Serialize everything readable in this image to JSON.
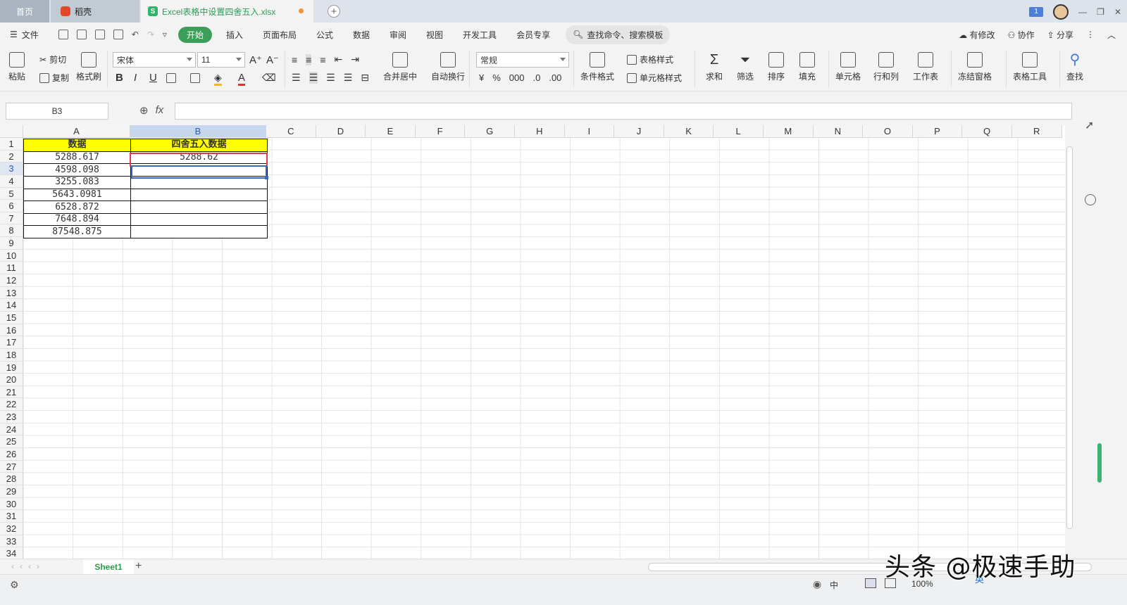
{
  "tabs": {
    "home": "首页",
    "daoke": "稻壳",
    "file_icon_letter": "S",
    "file": "Excel表格中设置四舍五入.xlsx"
  },
  "window_badge": "1",
  "menu": {
    "file": "文件",
    "items": [
      "开始",
      "插入",
      "页面布局",
      "公式",
      "数据",
      "审阅",
      "视图",
      "开发工具",
      "会员专享"
    ],
    "search": "查找命令、搜索模板",
    "right": [
      "有修改",
      "协作",
      "分享"
    ]
  },
  "ribbon": {
    "paste": "粘贴",
    "cut": "剪切",
    "copy": "复制",
    "format_painter": "格式刷",
    "font_name": "宋体",
    "font_size": "11",
    "merge_center": "合并居中",
    "wrap": "自动换行",
    "number_format": "常规",
    "cond_format": "条件格式",
    "table_style": "表格样式",
    "cell_style": "单元格样式",
    "sum": "求和",
    "filter": "筛选",
    "sort": "排序",
    "fill": "填充",
    "cell": "单元格",
    "row_col": "行和列",
    "worksheet": "工作表",
    "freeze": "冻结窗格",
    "table_tools": "表格工具",
    "find": "查找"
  },
  "formula_bar": {
    "name_box": "B3",
    "fx": "fx",
    "formula": ""
  },
  "columns": [
    "A",
    "B",
    "C",
    "D",
    "E",
    "F",
    "G",
    "H",
    "I",
    "J",
    "K",
    "L",
    "M",
    "N",
    "O",
    "P",
    "Q",
    "R"
  ],
  "rows": [
    "1",
    "2",
    "3",
    "4",
    "5",
    "6",
    "7",
    "8",
    "9",
    "10",
    "11",
    "12",
    "13",
    "14",
    "15",
    "16",
    "17",
    "18",
    "19",
    "20",
    "21",
    "22",
    "23",
    "24",
    "25",
    "26",
    "27",
    "28",
    "29",
    "30",
    "31",
    "32",
    "33",
    "34"
  ],
  "table": {
    "header_a": "数据",
    "header_b": "四舍五入数据",
    "rows": [
      {
        "a": "5288.617",
        "b": "5288.62"
      },
      {
        "a": "4598.098",
        "b": ""
      },
      {
        "a": "3255.083",
        "b": ""
      },
      {
        "a": "5643.0981",
        "b": ""
      },
      {
        "a": "6528.872",
        "b": ""
      },
      {
        "a": "7648.894",
        "b": ""
      },
      {
        "a": "87548.875",
        "b": ""
      }
    ]
  },
  "sheet_tab": "Sheet1",
  "status": {
    "zoom": "100%",
    "ime": "中",
    "ime2": "英"
  },
  "watermark": "头条 @极速手助"
}
